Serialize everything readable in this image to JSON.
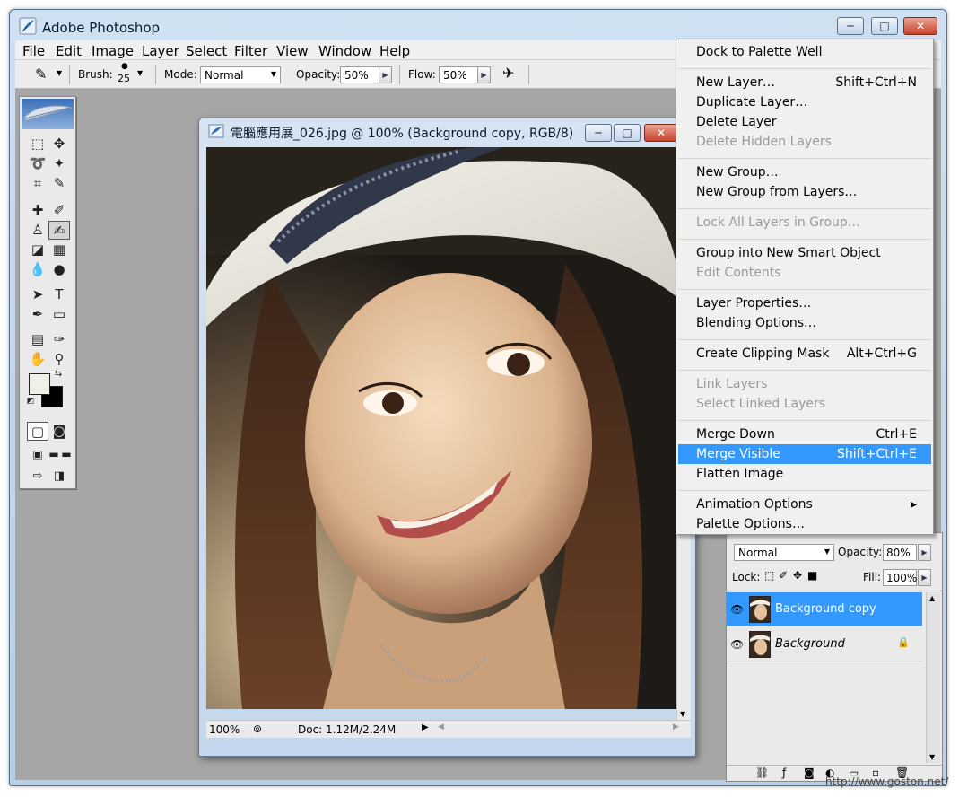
{
  "window": {
    "title": "Adobe Photoshop",
    "minimize_glyph": "─",
    "maximize_glyph": "□",
    "close_glyph": "✕"
  },
  "menu_bar": [
    "File",
    "Edit",
    "Image",
    "Layer",
    "Select",
    "Filter",
    "View",
    "Window",
    "Help"
  ],
  "options_bar": {
    "brush_label": "Brush:",
    "brush_size": "25",
    "mode_label": "Mode:",
    "mode_value": "Normal",
    "opacity_label": "Opacity:",
    "opacity_value": "50%",
    "flow_label": "Flow:",
    "flow_value": "50%"
  },
  "document": {
    "title": "電腦應用展_026.jpg @ 100% (Background copy, RGB/8)",
    "zoom": "100%",
    "doc_size": "Doc: 1.12M/2.24M"
  },
  "context_menu": {
    "items": [
      {
        "label": "Dock to Palette Well",
        "shortcut": "",
        "disabled": false
      },
      {
        "label": "New Layer…",
        "shortcut": "Shift+Ctrl+N",
        "disabled": false
      },
      {
        "label": "Duplicate Layer…",
        "shortcut": "",
        "disabled": false
      },
      {
        "label": "Delete Layer",
        "shortcut": "",
        "disabled": false
      },
      {
        "label": "Delete Hidden Layers",
        "shortcut": "",
        "disabled": true
      },
      {
        "label": "New Group…",
        "shortcut": "",
        "disabled": false
      },
      {
        "label": "New Group from Layers…",
        "shortcut": "",
        "disabled": false
      },
      {
        "label": "Lock All Layers in Group…",
        "shortcut": "",
        "disabled": true
      },
      {
        "label": "Group into New Smart Object",
        "shortcut": "",
        "disabled": false
      },
      {
        "label": "Edit Contents",
        "shortcut": "",
        "disabled": true
      },
      {
        "label": "Layer Properties…",
        "shortcut": "",
        "disabled": false
      },
      {
        "label": "Blending Options…",
        "shortcut": "",
        "disabled": false
      },
      {
        "label": "Create Clipping Mask",
        "shortcut": "Alt+Ctrl+G",
        "disabled": false
      },
      {
        "label": "Link Layers",
        "shortcut": "",
        "disabled": true
      },
      {
        "label": "Select Linked Layers",
        "shortcut": "",
        "disabled": true
      },
      {
        "label": "Merge Down",
        "shortcut": "Ctrl+E",
        "disabled": false
      },
      {
        "label": "Merge Visible",
        "shortcut": "Shift+Ctrl+E",
        "disabled": false,
        "highlighted": true
      },
      {
        "label": "Flatten Image",
        "shortcut": "",
        "disabled": false
      },
      {
        "label": "Animation Options",
        "shortcut": "▸",
        "disabled": false
      },
      {
        "label": "Palette Options…",
        "shortcut": "",
        "disabled": false
      }
    ]
  },
  "layers_palette": {
    "blend_mode": "Normal",
    "opacity_label": "Opacity:",
    "opacity_value": "80%",
    "lock_label": "Lock:",
    "fill_label": "Fill:",
    "fill_value": "100%",
    "layers": [
      {
        "name": "Background copy",
        "selected": true
      },
      {
        "name": "Background",
        "selected": false,
        "locked": true
      }
    ]
  },
  "watermark": "http://www.goston.net/",
  "colors": {
    "highlight": "#3399ff",
    "foreground": "#f0efe8",
    "background": "#000000"
  }
}
